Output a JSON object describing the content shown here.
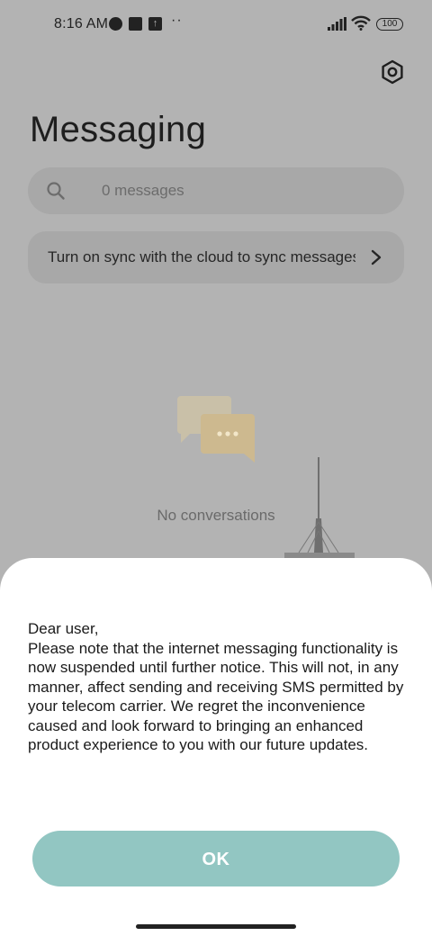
{
  "status_bar": {
    "time": "8:16 AM",
    "overflow": "··",
    "battery": "100",
    "icons": [
      "motorola-icon",
      "square-app-icon",
      "upload-icon",
      "signal-icon",
      "wifi-icon",
      "battery-icon"
    ]
  },
  "header": {
    "title": "Messaging",
    "settings_icon": "settings-hex-icon"
  },
  "search": {
    "placeholder": "0 messages",
    "icon": "search-icon"
  },
  "sync_banner": {
    "text": "Turn on sync with the cloud to sync messages",
    "icon": "chevron-right-icon"
  },
  "empty_state": {
    "text": "No conversations",
    "icon": "chat-bubbles-icon"
  },
  "dialog": {
    "message": "Dear user,\nPlease note that the internet messaging functionality is now suspended until further notice. This will not, in any manner, affect sending and receiving SMS permitted by your telecom carrier. We regret the inconvenience caused and look forward to bringing an enhanced product experience to you with our future updates.",
    "ok_label": "OK"
  },
  "colors": {
    "scrim_background": "#b3b3b3",
    "card": "#a8a8a8",
    "ok_button": "#92c6c2",
    "sheet": "#ffffff"
  }
}
